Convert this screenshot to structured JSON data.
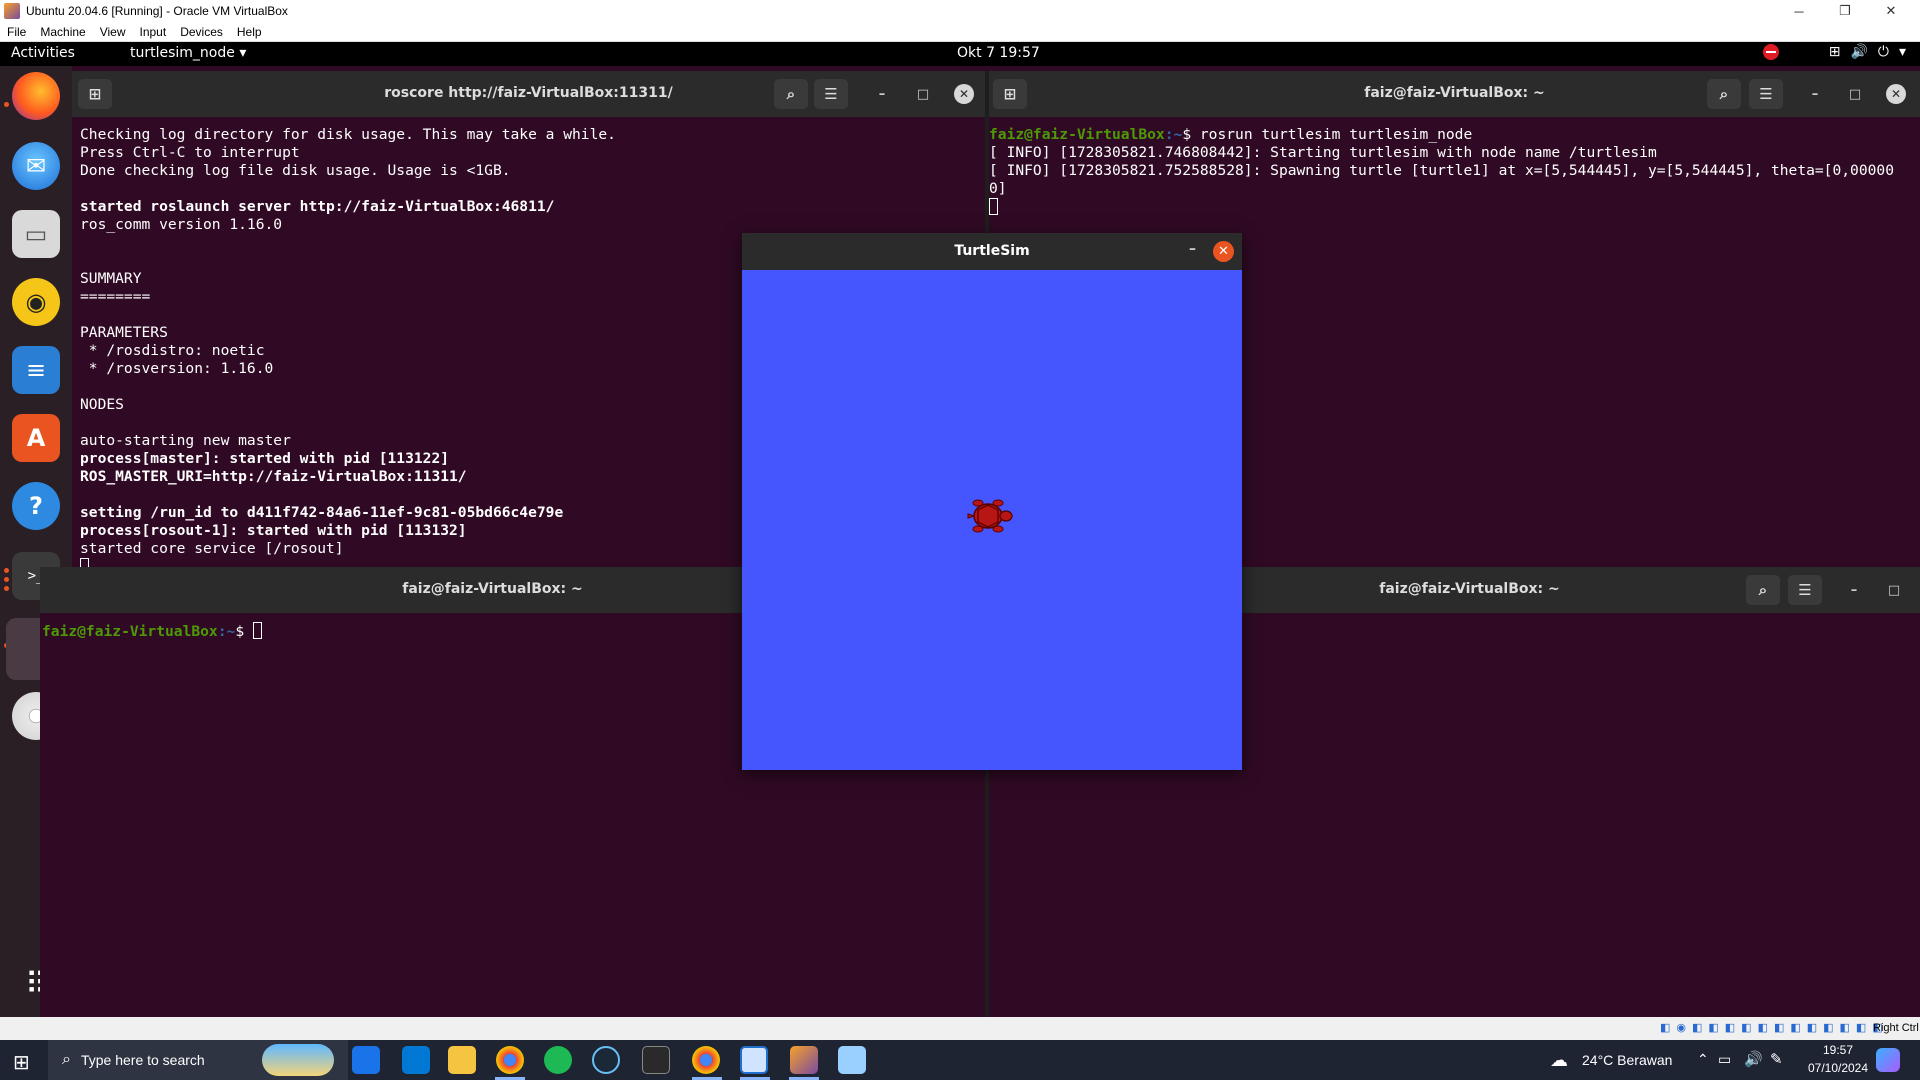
{
  "vbox": {
    "window_title": "Ubuntu 20.04.6 [Running] - Oracle VM VirtualBox",
    "menu": [
      "File",
      "Machine",
      "View",
      "Input",
      "Devices",
      "Help"
    ],
    "status_right": "Right Ctrl"
  },
  "topbar": {
    "activities": "Activities",
    "app_menu": "turtlesim_node ▾",
    "clock": "Okt 7  19:57"
  },
  "dock": {
    "items": [
      "firefox-icon",
      "thunderbird-icon",
      "files-icon",
      "rhythmbox-icon",
      "writer-icon",
      "software-icon",
      "help-icon",
      "terminal-icon",
      "active-app",
      "dvd-icon"
    ],
    "apps_grid": "show-applications-icon"
  },
  "term_roscore": {
    "title": "roscore http://faiz-VirtualBox:11311/",
    "lines": [
      {
        "t": "Checking log directory for disk usage. This may take a while.",
        "b": false
      },
      {
        "t": "Press Ctrl-C to interrupt",
        "b": false
      },
      {
        "t": "Done checking log file disk usage. Usage is <1GB.",
        "b": false
      },
      {
        "t": "",
        "b": false
      },
      {
        "t": "started roslaunch server http://faiz-VirtualBox:46811/",
        "b": true
      },
      {
        "t": "ros_comm version 1.16.0",
        "b": false
      },
      {
        "t": "",
        "b": false
      },
      {
        "t": "",
        "b": false
      },
      {
        "t": "SUMMARY",
        "b": false
      },
      {
        "t": "========",
        "b": false
      },
      {
        "t": "",
        "b": false
      },
      {
        "t": "PARAMETERS",
        "b": false
      },
      {
        "t": " * /rosdistro: noetic",
        "b": false
      },
      {
        "t": " * /rosversion: 1.16.0",
        "b": false
      },
      {
        "t": "",
        "b": false
      },
      {
        "t": "NODES",
        "b": false
      },
      {
        "t": "",
        "b": false
      },
      {
        "t": "auto-starting new master",
        "b": false
      },
      {
        "t": "process[master]: started with pid [113122]",
        "b": true
      },
      {
        "t": "ROS_MASTER_URI=http://faiz-VirtualBox:11311/",
        "b": true
      },
      {
        "t": "",
        "b": false
      },
      {
        "t": "setting /run_id to d411f742-84a6-11ef-9c81-05bd66c4e79e",
        "b": true
      },
      {
        "t": "process[rosout-1]: started with pid [113132]",
        "b": true
      },
      {
        "t": "started core service [/rosout]",
        "b": false
      }
    ]
  },
  "term_turtlesim": {
    "title": "faiz@faiz-VirtualBox: ~",
    "prompt_user": "faiz@faiz-VirtualBox",
    "prompt_path": ":~",
    "command": "$ rosrun turtlesim turtlesim_node",
    "log1": "[ INFO] [1728305821.746808442]: Starting turtlesim with node name /turtlesim",
    "log2": "[ INFO] [1728305821.752588528]: Spawning turtle [turtle1] at x=[5,544445], y=[5,544445], theta=[0,00000",
    "log3": "0]"
  },
  "term_bl": {
    "title": "faiz@faiz-VirtualBox: ~",
    "prompt_user": "faiz@faiz-VirtualBox",
    "prompt_path": ":~",
    "prompt_end": "$ "
  },
  "term_br": {
    "title": "faiz@faiz-VirtualBox: ~"
  },
  "turtlesim": {
    "title": "TurtleSim",
    "background": "#4556ff"
  },
  "taskbar": {
    "search_placeholder": "Type here to search",
    "weather": "24°C  Berawan",
    "time": "19:57",
    "date": "07/10/2024"
  }
}
